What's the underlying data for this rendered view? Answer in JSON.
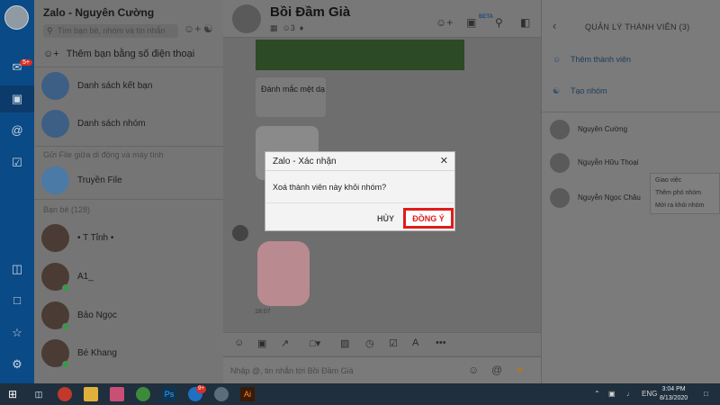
{
  "sidebar": {
    "chat_badge": "5+"
  },
  "contacts_panel": {
    "title": "Zalo - Nguyên Cường",
    "search_placeholder": "Tìm bạn bè, nhóm và tin nhắn",
    "add_by_phone": "Thêm bạn bằng số điện thoại",
    "items": [
      {
        "label": "Danh sách kết bạn"
      },
      {
        "label": "Danh sách nhóm"
      }
    ],
    "file_section_label": "Gửi File giữa di động và máy tính",
    "file_transfer": "Truyền File",
    "friends_header": "Bạn bè (128)",
    "friends": [
      {
        "name": "• T Tỉnh •"
      },
      {
        "name": "A1_"
      },
      {
        "name": "Bảo Ngọc"
      },
      {
        "name": "Bé Khang"
      }
    ]
  },
  "chat": {
    "group_name": "Bồi Đầm Già",
    "member_count": "3",
    "beta_label": "BETA",
    "message_text": "Đánh mắc mệt dạ",
    "sticker_time": "18:07",
    "composer_placeholder": "Nhập @, tin nhắn tới Bồi Đầm Già"
  },
  "members_panel": {
    "title": "QUẢN LÝ THÀNH VIÊN (3)",
    "add_member": "Thêm thành viên",
    "create_group": "Tạo nhóm",
    "members": [
      {
        "name": "Nguyên Cường"
      },
      {
        "name": "Nguyễn Hữu Thoại"
      },
      {
        "name": "Nguyễn Ngọc Châu"
      }
    ],
    "context_menu": [
      "Giao việc",
      "Thêm phó nhóm",
      "Mời ra khỏi nhóm"
    ]
  },
  "dialog": {
    "title": "Zalo - Xác nhận",
    "message": "Xoá thành viên này khỏi nhóm?",
    "cancel_label": "HỦY",
    "confirm_label": "ĐỒNG Ý"
  },
  "taskbar": {
    "badge": "9+",
    "language": "ENG",
    "time": "3:04 PM",
    "date": "8/13/2020"
  },
  "colors": {
    "confirm_highlight": "#e01b1b",
    "rail": "#0a4a86"
  }
}
